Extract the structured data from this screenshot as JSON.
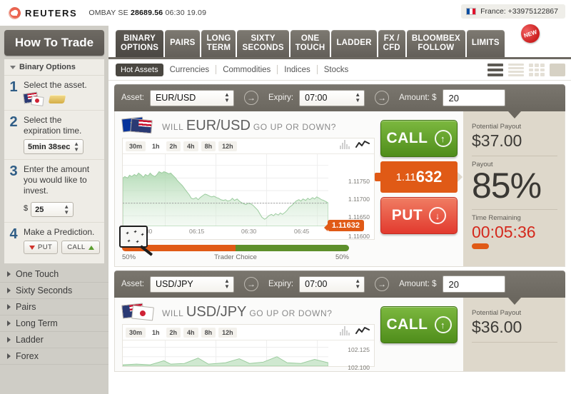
{
  "topbar": {
    "brand": "REUTERS",
    "ticker_text": "OMBAY SE",
    "ticker_value": "28689.56",
    "ticker_time": "06:30 19.09",
    "country": "France: +33975122867"
  },
  "nav": {
    "tabs": [
      {
        "label": "BINARY\nOPTIONS",
        "active": true
      },
      {
        "label": "PAIRS",
        "active": false
      },
      {
        "label": "LONG\nTERM",
        "active": false
      },
      {
        "label": "SIXTY\nSECONDS",
        "active": false
      },
      {
        "label": "ONE\nTOUCH",
        "active": false
      },
      {
        "label": "LADDER",
        "active": false
      },
      {
        "label": "FX /\nCFD",
        "active": false
      },
      {
        "label": "BLOOMBEX\nFOLLOW",
        "active": false
      },
      {
        "label": "LIMITS",
        "active": false
      }
    ],
    "badge": "NEW"
  },
  "subtabs": {
    "items": [
      "Hot Assets",
      "Currencies",
      "Commodities",
      "Indices",
      "Stocks"
    ],
    "active": "Hot Assets",
    "view_icons": [
      "list-view-icon",
      "rows-view-icon",
      "grid-view-icon",
      "single-view-icon"
    ]
  },
  "sidebar": {
    "title": "How To Trade",
    "accordion_open": "Binary Options",
    "steps": [
      {
        "num": "1",
        "text": "Select the asset.",
        "icons": [
          "currency-flags-icon",
          "gold-bar-icon"
        ]
      },
      {
        "num": "2",
        "text": "Select the expiration time.",
        "control": "5min 38sec"
      },
      {
        "num": "3",
        "text": "Enter the amount you would like to invest.",
        "currency": "$",
        "control": "25"
      },
      {
        "num": "4",
        "text": "Make a Prediction.",
        "put_label": "PUT",
        "call_label": "CALL"
      }
    ],
    "links": [
      "One Touch",
      "Sixty Seconds",
      "Pairs",
      "Long Term",
      "Ladder",
      "Forex"
    ]
  },
  "panels": [
    {
      "asset_label": "Asset:",
      "asset_value": "EUR/USD",
      "expiry_label": "Expiry:",
      "expiry_value": "07:00",
      "amount_label": "Amount: $",
      "amount_value": "20",
      "question_pre": "WILL",
      "question_pair": "EUR/USD",
      "question_post": "GO UP OR DOWN?",
      "flags": [
        "eu-flag-icon",
        "us-flag-icon"
      ],
      "timeframes": [
        "30m",
        "1h",
        "2h",
        "4h",
        "8h",
        "12h"
      ],
      "active_timeframe": "30m",
      "current_price_prefix": "1.11",
      "current_price_suffix": "632",
      "current_price_full": "1.11632",
      "call_label": "CALL",
      "put_label": "PUT",
      "potential_payout_label": "Potential Payout",
      "potential_payout_value": "$37.00",
      "payout_label": "Payout",
      "payout_value": "85%",
      "time_label": "Time Remaining",
      "time_value": "00:05:36",
      "trader_choice_label": "Trader Choice",
      "trader_left_pct": "50%",
      "trader_right_pct": "50%",
      "chart_data": {
        "type": "area",
        "title": "EUR/USD 30m",
        "xlabel": "",
        "ylabel": "",
        "ylim": [
          1.11575,
          1.11775
        ],
        "yticks": [
          "1.11750",
          "1.11700",
          "1.11650",
          "1.11600"
        ],
        "ytick_values": [
          1.1175,
          1.117,
          1.1165,
          1.116
        ],
        "xticks": [
          "06:00",
          "06:15",
          "06:30",
          "06:45"
        ],
        "grid": true,
        "legend": "none",
        "marker_line": 1.11632,
        "color": "#b7dcb9",
        "series": [
          {
            "name": "EUR/USD",
            "values": [
              1.11706,
              1.11709,
              1.11705,
              1.11712,
              1.11708,
              1.11714,
              1.1171,
              1.11718,
              1.11712,
              1.11707,
              1.11716,
              1.11712,
              1.11719,
              1.11714,
              1.1171,
              1.11716,
              1.11723,
              1.1172,
              1.11724,
              1.11722,
              1.11719,
              1.11721,
              1.11715,
              1.11708,
              1.117,
              1.11694,
              1.11686,
              1.11678,
              1.1167,
              1.1166,
              1.1165,
              1.11648,
              1.11651,
              1.11647,
              1.11652,
              1.11658,
              1.11662,
              1.11659,
              1.11656,
              1.11654,
              1.11657,
              1.11652,
              1.1165,
              1.11647,
              1.11645,
              1.11648,
              1.11643,
              1.11646,
              1.1165,
              1.11645,
              1.11648,
              1.11644,
              1.1164,
              1.11636,
              1.11634,
              1.11637,
              1.11635,
              1.11631,
              1.11627,
              1.1162,
              1.1161,
              1.11601,
              1.11596,
              1.116,
              1.11605,
              1.11608,
              1.11604,
              1.11609,
              1.11606,
              1.11611,
              1.11608,
              1.11613,
              1.11618,
              1.11624,
              1.1163,
              1.11636,
              1.1164,
              1.11637,
              1.11641,
              1.11638,
              1.11643,
              1.1164,
              1.11645,
              1.11643,
              1.11646,
              1.11644,
              1.1164,
              1.11638,
              1.11636,
              1.11632
            ]
          }
        ]
      }
    },
    {
      "asset_label": "Asset:",
      "asset_value": "USD/JPY",
      "expiry_label": "Expiry:",
      "expiry_value": "07:00",
      "amount_label": "Amount: $",
      "amount_value": "20",
      "question_pre": "WILL",
      "question_pair": "USD/JPY",
      "question_post": "GO UP OR DOWN?",
      "flags": [
        "us-flag-icon",
        "jp-flag-icon"
      ],
      "timeframes": [
        "30m",
        "1h",
        "2h",
        "4h",
        "8h",
        "12h"
      ],
      "active_timeframe": "30m",
      "call_label": "CALL",
      "potential_payout_label": "Potential Payout",
      "potential_payout_value": "$36.00",
      "chart_data": {
        "type": "area",
        "title": "USD/JPY 30m",
        "xlabel": "",
        "ylabel": "",
        "ylim": [
          102.09,
          102.135
        ],
        "yticks": [
          "102.125",
          "102.100"
        ],
        "ytick_values": [
          102.125,
          102.1
        ],
        "xticks": [],
        "grid": true,
        "legend": "none",
        "color": "#b7dcb9",
        "series": [
          {
            "name": "USD/JPY",
            "values": [
              102.095,
              102.094,
              102.096,
              102.095,
              102.097,
              102.096,
              102.098,
              102.1,
              102.097,
              102.095,
              102.096,
              102.098,
              102.101,
              102.099,
              102.096,
              102.095,
              102.097,
              102.103,
              102.1,
              102.096,
              102.095,
              102.097,
              102.099,
              102.104,
              102.101,
              102.097,
              102.095,
              102.096,
              102.098,
              102.102
            ]
          }
        ]
      }
    }
  ]
}
